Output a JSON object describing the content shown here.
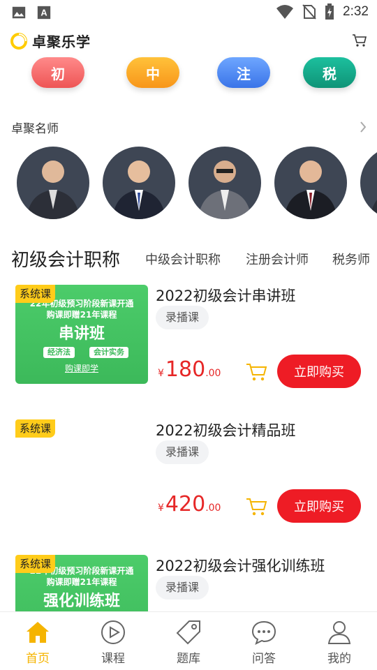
{
  "status_bar": {
    "time": "2:32"
  },
  "header": {
    "app_name": "卓聚乐学"
  },
  "categories": [
    {
      "label": "初",
      "color": "#f36a6a"
    },
    {
      "label": "中",
      "color": "#f9a21a"
    },
    {
      "label": "注",
      "color": "#4a84ee"
    },
    {
      "label": "税",
      "color": "#14a58a"
    }
  ],
  "teachers": {
    "title": "卓聚名师"
  },
  "tabs": [
    "初级会计职称",
    "中级会计职称",
    "注册会计师",
    "税务师"
  ],
  "courses": [
    {
      "badge": "系统课",
      "title": "2022初级会计串讲班",
      "tag": "录播课",
      "price_symbol": "¥",
      "price_int": "180",
      "price_dec": ".00",
      "buy_label": "立即购买",
      "thumb_line1": "22年初级预习阶段新课开通",
      "thumb_line2": "购课即赠21年课程",
      "thumb_main": "串讲班",
      "thumb_chip1": "经济法",
      "thumb_chip2": "会计实务",
      "thumb_link": "购课即学"
    },
    {
      "badge": "系统课",
      "title": "2022初级会计精品班",
      "tag": "录播课",
      "price_symbol": "¥",
      "price_int": "420",
      "price_dec": ".00",
      "buy_label": "立即购买"
    },
    {
      "badge": "系统课",
      "title": "2022初级会计强化训练班",
      "tag": "录播课",
      "thumb_line1": "22年初级预习阶段新课开通",
      "thumb_line2": "购课即赠21年课程",
      "thumb_main": "强化训练班"
    }
  ],
  "bottom_nav": [
    {
      "label": "首页",
      "icon": "home-icon",
      "active": true
    },
    {
      "label": "课程",
      "icon": "play-icon"
    },
    {
      "label": "题库",
      "icon": "tag-icon"
    },
    {
      "label": "问答",
      "icon": "chat-icon"
    },
    {
      "label": "我的",
      "icon": "user-icon"
    }
  ],
  "colors": {
    "accent": "#f5b400",
    "price": "#e62727",
    "buy": "#ee1c25",
    "badge": "#ffcc1a"
  }
}
